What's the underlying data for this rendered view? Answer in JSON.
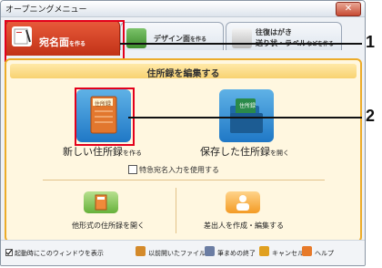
{
  "window": {
    "title": "オープニングメニュー",
    "close_glyph": "✕"
  },
  "tabs": [
    {
      "label": "宛名面",
      "suffix": "を作る"
    },
    {
      "label": "デザイン面",
      "suffix": "を作る"
    },
    {
      "label_line1": "往復はがき",
      "label_line2": "送り状・ラベル",
      "suffix": "などを作る"
    }
  ],
  "section": {
    "title": "住所録を編集する"
  },
  "actions": {
    "new": {
      "label": "新しい住所録",
      "suffix": "を作る",
      "icon_text": "住所録"
    },
    "open": {
      "label": "保存した住所録",
      "suffix": "を開く",
      "icon_text": "住所録"
    },
    "urgent_checkbox": {
      "label": "特急宛名入力を使用する",
      "checked": false
    },
    "other_format": {
      "label": "他形式の住所録を開く"
    },
    "sender": {
      "label": "差出人を作成・編集する"
    }
  },
  "footer": {
    "startup_checkbox": {
      "label": "起動時にこのウィンドウを表示",
      "checked": true
    },
    "recent": "以前開いたファイル",
    "exit": "筆まめの終了",
    "cancel": "キャンセル",
    "help": "ヘルプ"
  },
  "callouts": [
    "1",
    "2"
  ],
  "colors": {
    "accent": "#d23b1c",
    "panel_border": "#ecac2a",
    "panel_bg": "#fff7e0",
    "highlight": "#e3001b"
  }
}
